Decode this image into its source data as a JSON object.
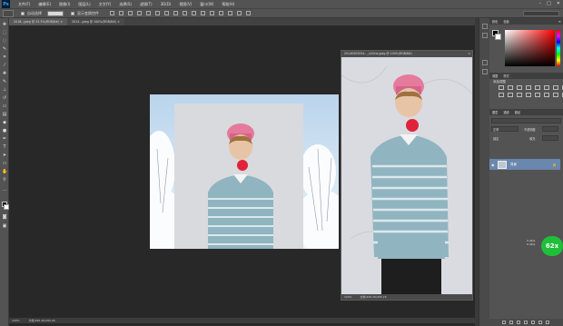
{
  "app": {
    "logo": "Ps"
  },
  "menu": [
    "文件(F)",
    "编辑(E)",
    "图像(I)",
    "图层(L)",
    "文字(Y)",
    "选择(S)",
    "滤镜(T)",
    "3D(D)",
    "视图(V)",
    "窗口(W)",
    "帮助(H)"
  ],
  "window_controls": [
    "–",
    "□",
    "✕"
  ],
  "options": {
    "auto_select": "自动选择",
    "show_transform": "显示变换控件"
  },
  "tabs": [
    {
      "label": "2016...jpeg @ 33.3%(RGB/8#) ×"
    },
    {
      "label": "2014...jpeg @ 100%(RGB/8#) ×"
    }
  ],
  "doc1": {
    "zoom_status": "33.33%",
    "file_info": "文档:495.2K/495.2K"
  },
  "doc2": {
    "title": "20140505054..._n2Gne.jpeg @ 100%(RGB/8#)",
    "close": "×",
    "zoom": "100%",
    "file_info": "文档:495.2K/495.2K"
  },
  "status": {
    "zoom": "100%",
    "info": "文档:495.2K/495.2K"
  },
  "panel": {
    "tabs_color": [
      "颜色",
      "色板"
    ],
    "adjust_title": "添加调整",
    "tabs_adjust": [
      "调整",
      "样式"
    ],
    "layers_tabs": [
      "图层",
      "通道",
      "路径"
    ],
    "mode": "正常",
    "opacity_label": "不透明度",
    "lock_label": "锁定",
    "fill_label": "填充",
    "layer_name": "背景"
  },
  "net": {
    "speed": "62x",
    "up": "0.4K/s",
    "down": "0.4K/s"
  }
}
